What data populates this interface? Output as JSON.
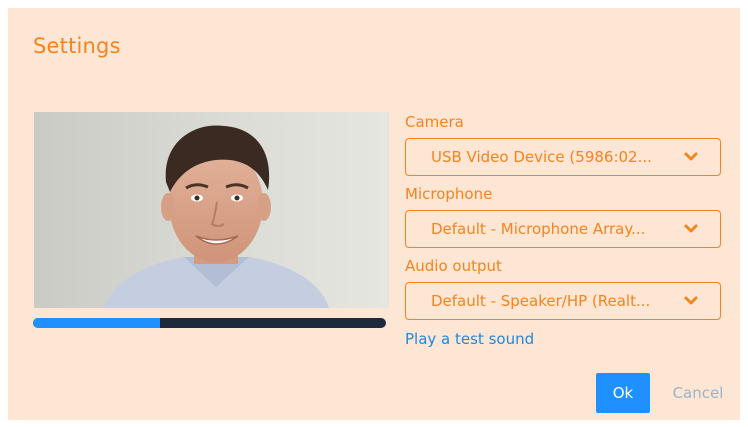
{
  "dialog": {
    "title": "Settings"
  },
  "preview": {
    "audio_level_fraction": 0.36
  },
  "camera": {
    "label": "Camera",
    "value": "USB Video Device (5986:02..."
  },
  "microphone": {
    "label": "Microphone",
    "value": "Default - Microphone Array..."
  },
  "audio_output": {
    "label": "Audio output",
    "value": "Default - Speaker/HP (Realt..."
  },
  "test_sound": {
    "label": "Play a test sound"
  },
  "actions": {
    "ok_label": "Ok",
    "cancel_label": "Cancel"
  },
  "colors": {
    "accent": "#f5831f",
    "primary": "#1e90ff",
    "background": "#fde6d3",
    "level_track": "#1d2a3e"
  }
}
